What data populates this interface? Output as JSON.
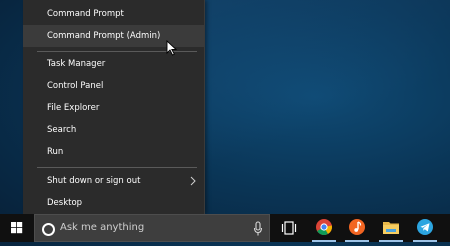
{
  "power_menu": {
    "items": [
      {
        "label": "Command Prompt",
        "hover": false
      },
      {
        "label": "Command Prompt (Admin)",
        "hover": true
      },
      {
        "label": "Task Manager"
      },
      {
        "label": "Control Panel"
      },
      {
        "label": "File Explorer"
      },
      {
        "label": "Search"
      },
      {
        "label": "Run"
      },
      {
        "label": "Shut down or sign out",
        "has_submenu": true
      },
      {
        "label": "Desktop"
      }
    ]
  },
  "taskbar": {
    "search_placeholder": "Ask me anything",
    "icons": [
      "windows-start-icon",
      "microphone-icon",
      "task-view-icon",
      "chrome-icon",
      "music-app-icon",
      "file-explorer-icon",
      "telegram-icon"
    ]
  },
  "colors": {
    "menu_bg": "#2b2b2b",
    "taskbar_bg": "#101010",
    "search_bg": "#3e3e3e",
    "accent": "#9ec3e6"
  }
}
